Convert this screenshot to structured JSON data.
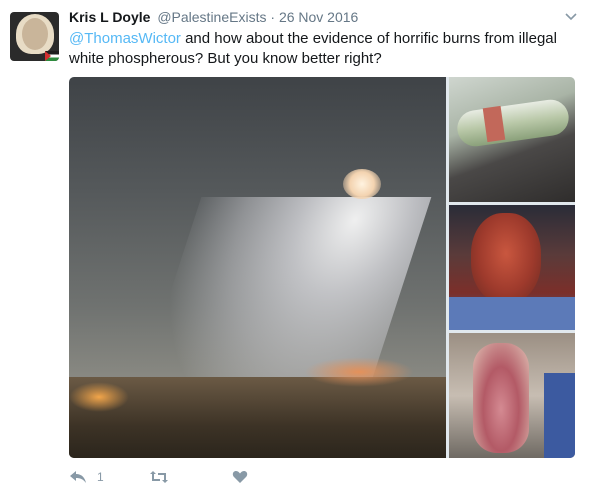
{
  "tweet": {
    "fullname": "Kris L Doyle",
    "username": "@PalestineExists",
    "separator": "·",
    "timestamp": "26 Nov 2016",
    "mention": "@ThomasWictor",
    "body": " and how about the evidence of horrific burns from illegal white phospherous? But you know better right?"
  },
  "actions": {
    "reply_count": "1"
  },
  "icons": {
    "caret": "chevron-down-icon",
    "reply": "reply-icon",
    "retweet": "retweet-icon",
    "like": "heart-icon"
  },
  "colors": {
    "link": "#1da1f2",
    "secondary_text": "#657786",
    "icon": "#8899a6"
  }
}
